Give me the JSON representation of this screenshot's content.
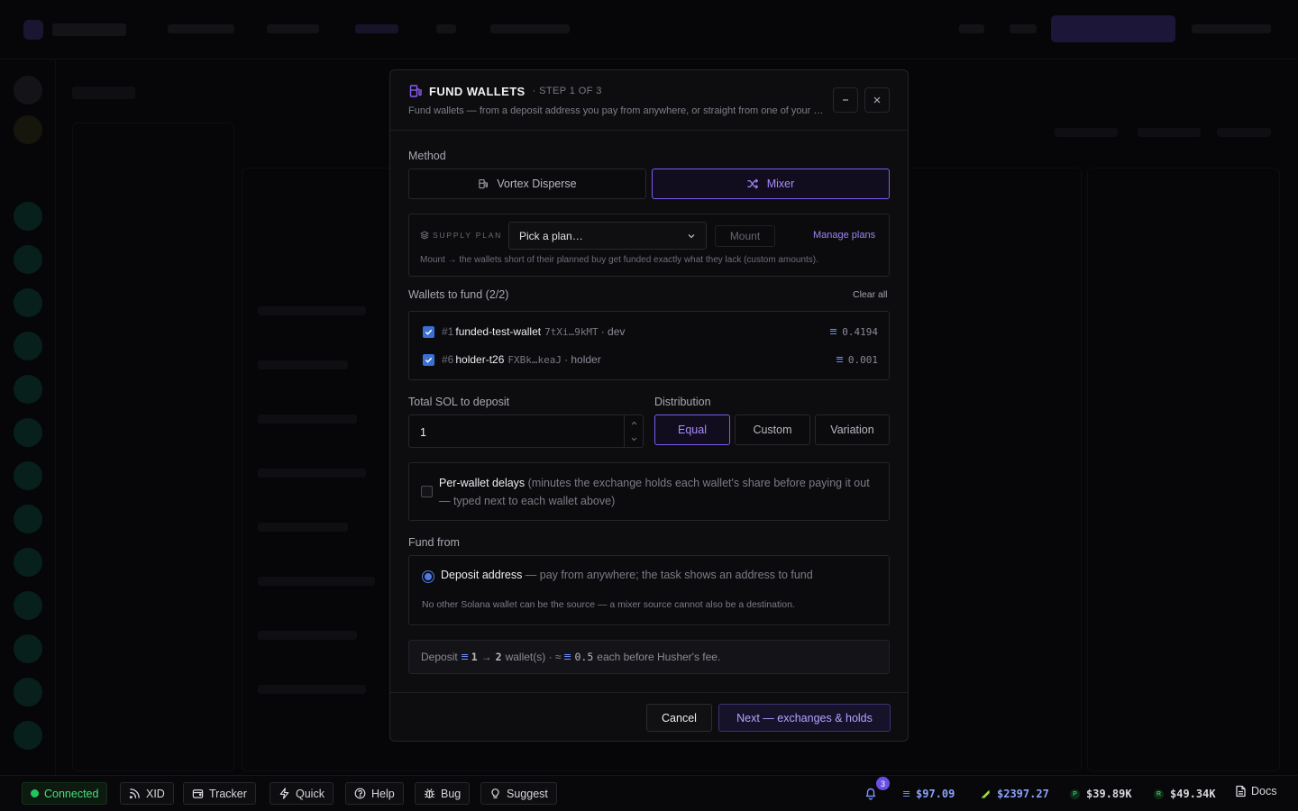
{
  "modal": {
    "title": "FUND WALLETS",
    "step": "· STEP 1 OF 3",
    "subtitle": "Fund wallets — from a deposit address you pay from anywhere, or straight from one of your wallets.",
    "method_label": "Method",
    "methods": [
      {
        "label": "Vortex Disperse",
        "active": false
      },
      {
        "label": "Mixer",
        "active": true
      }
    ],
    "supply_plan": {
      "label": "SUPPLY PLAN",
      "placeholder": "Pick a plan…",
      "mount_label": "Mount",
      "manage_label": "Manage plans",
      "note": "Mount → the wallets short of their planned buy get funded exactly what they lack (custom amounts)."
    },
    "wallets_label": "Wallets to fund (2/2)",
    "clear_all": "Clear all",
    "wallets": [
      {
        "index": "#1",
        "name": "funded-test-wallet",
        "address": "7tXi…9kMT",
        "tag": "· dev",
        "balance": "0.4194",
        "checked": true
      },
      {
        "index": "#6",
        "name": "holder-t26",
        "address": "FXBk…keaJ",
        "tag": "· holder",
        "balance": "0.001",
        "checked": true
      }
    ],
    "total_label": "Total SOL to deposit",
    "total_value": "1",
    "distribution_label": "Distribution",
    "distribution": [
      {
        "label": "Equal",
        "active": true
      },
      {
        "label": "Custom",
        "active": false
      },
      {
        "label": "Variation",
        "active": false
      }
    ],
    "delays": {
      "checked": false,
      "title": "Per-wallet delays",
      "description": " (minutes the exchange holds each wallet's share before paying it out — typed next to each wallet above)"
    },
    "fund_from_label": "Fund from",
    "fund_from": {
      "option_title": "Deposit address",
      "option_desc": " — pay from anywhere; the task shows an address to fund",
      "note": "No other Solana wallet can be the source — a mixer source cannot also be a destination."
    },
    "summary": {
      "prefix": "Deposit",
      "amount": "1",
      "arrow": "→",
      "count": "2",
      "wallets_text": "wallet(s) · ≈",
      "each": "0.5",
      "suffix": "each before Husher's fee."
    },
    "cancel_label": "Cancel",
    "next_label": "Next — exchanges & holds"
  },
  "bottombar": {
    "connected": "Connected",
    "buttons": [
      "XID",
      "Tracker",
      "Quick",
      "Help",
      "Bug",
      "Suggest"
    ],
    "notifications": "3",
    "prices": [
      {
        "icon": "solana-icon",
        "value": "$97.09",
        "color": "#6d8dff"
      },
      {
        "icon": "eth-icon",
        "value": "$2397.27",
        "color": "#a3e635"
      },
      {
        "icon": "p-icon",
        "value": "$39.89K",
        "color": "#22c55e"
      },
      {
        "icon": "r-icon",
        "value": "$49.34K",
        "color": "#22c55e"
      }
    ],
    "docs": "Docs"
  },
  "colors": {
    "accent": "#7c5cf0",
    "checkbox": "#3b6fd4",
    "connected": "#22c55e"
  }
}
